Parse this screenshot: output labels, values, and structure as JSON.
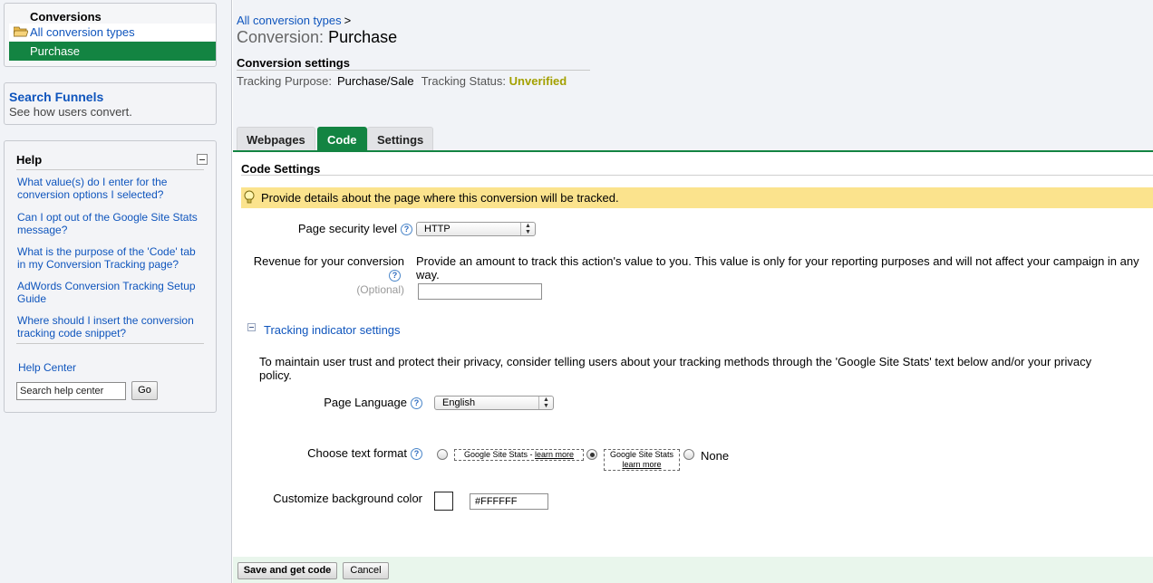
{
  "sidebar": {
    "conversions": {
      "title": "Conversions",
      "all_types": "All conversion types",
      "selected": "Purchase"
    },
    "funnels": {
      "title": "Search Funnels",
      "desc": "See how users convert."
    },
    "help": {
      "title": "Help",
      "questions": [
        "What value(s) do I enter for the conversion options I selected?",
        "Can I opt out of the Google Site Stats message?",
        "What is the purpose of the 'Code' tab in my Conversion Tracking page?",
        "AdWords Conversion Tracking Setup Guide",
        "Where should I insert the conversion tracking code snippet?"
      ],
      "help_center": "Help Center",
      "search_value": "Search help center",
      "go_label": "Go"
    }
  },
  "header": {
    "breadcrumb": "All conversion types",
    "breadcrumb_sep": ">",
    "title_prefix": "Conversion:",
    "title": "Purchase",
    "settings_title": "Conversion settings",
    "tracking_purpose_label": "Tracking Purpose:",
    "tracking_purpose_value": "Purchase/Sale",
    "tracking_status_label": "Tracking Status:",
    "tracking_status_value": "Unverified"
  },
  "tabs": [
    "Webpages",
    "Code",
    "Settings"
  ],
  "active_tab": "Code",
  "code_settings": {
    "title": "Code Settings",
    "notice": "Provide details about the page where this conversion will be tracked.",
    "security_label": "Page security level",
    "security_value": "HTTP",
    "revenue_label": "Revenue for your conversion",
    "revenue_optional": "(Optional)",
    "revenue_desc": "Provide an amount to track this action's value to you. This value is only for your reporting purposes and will not affect your campaign in any way.",
    "revenue_value": "",
    "tracking_indicator_label": "Tracking indicator settings",
    "privacy_text": "To maintain user trust and protect their privacy, consider telling users about your tracking methods through the 'Google Site Stats' text below and/or your privacy policy.",
    "language_label": "Page Language",
    "language_value": "English",
    "format_label": "Choose text format",
    "format_option1_text": "Google Site Stats - ",
    "format_option1_link": "learn more",
    "format_option2_text": "Google Site Stats",
    "format_option2_link": "learn more",
    "format_option3": "None",
    "bg_label": "Customize background color",
    "bg_value": "#FFFFFF"
  },
  "footer": {
    "save_label": "Save and get code",
    "cancel_label": "Cancel"
  },
  "colors": {
    "accent_green": "#138442",
    "notice_yellow": "#fbe38d",
    "link_blue": "#0f55bd",
    "status_unverified": "#a3a000"
  }
}
